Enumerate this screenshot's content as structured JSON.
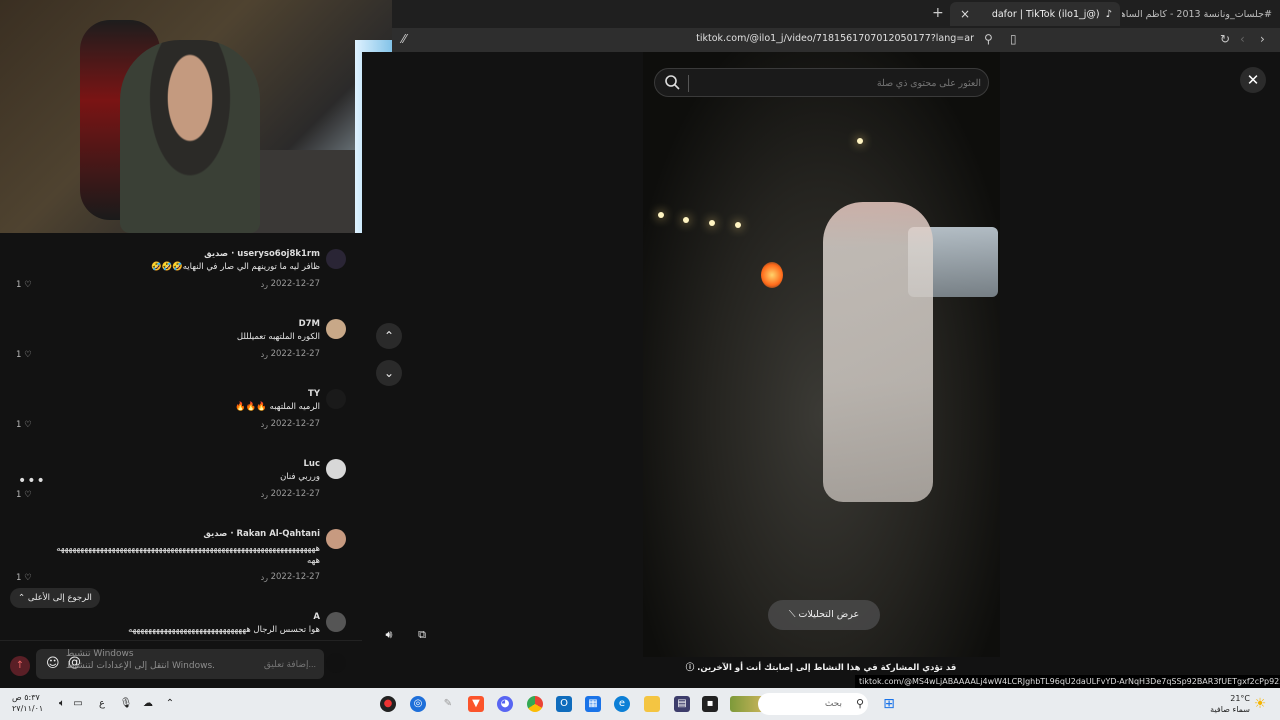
{
  "browser": {
    "active_tab_title": "(@ilo1_j) dafor | TikTok",
    "other_tab_title": "#جلسات_ونانسة 2013 - كاظم الساهر ...",
    "url": "tiktok.com/@ilo1_j/video/7181561707012050177?lang=ar"
  },
  "search": {
    "placeholder": "العثور على محتوى ذي صلة"
  },
  "comments": [
    {
      "user": "useryso6oj8k1rm · صديق",
      "text": "ظافر ليه ما تورينهم الي صار في النهايه🤣🤣🤣",
      "date": "2022-12-27",
      "reply": "رد",
      "likes": "1"
    },
    {
      "user": "D7M",
      "text": "الكوره الملتهبه تعميلللل",
      "date": "2022-12-27",
      "reply": "رد",
      "likes": "1"
    },
    {
      "user": "TY",
      "text": "الرميه الملتهبه 🔥🔥🔥",
      "date": "2022-12-27",
      "reply": "رد",
      "likes": "1"
    },
    {
      "user": "Luc",
      "text": "ورربي فنان",
      "date": "2022-12-27",
      "reply": "رد",
      "likes": "1"
    },
    {
      "user": "Rakan Al-Qahtani · صديق",
      "text": "ههههههههههههههههههههههههههههههههههههههههههههههههههههههههههههههههههه",
      "text2": "ههه",
      "date": "2022-12-27",
      "reply": "رد",
      "likes": "1"
    },
    {
      "user": "A",
      "text": "هوا تحسس الرجال ههههههههههههههههههههههههههههههه"
    }
  ],
  "back_to_top": "الرجوع إلى الأعلى ⌃",
  "comment_placeholder": "إضافة تعليق...",
  "activate_windows": [
    "تنشيط Windows",
    "انتقل إلى الإعدادات لتنشيط Windows."
  ],
  "video": {
    "analytics_label": "عرض التحليلات",
    "warning": "قد تؤدي المشاركة في هذا النشاط إلى إصابتك أنت أو الآخرين.",
    "status_url": "tiktok.com/@MS4wLjABAAAALj4wW4LCRJghbTL96qU2daULFvYD-ArNqH3De7qSSp92BAR3fUETgxf2cPp922vZ?lang=ar"
  },
  "taskbar": {
    "search_label": "بحث",
    "clock_time": "٥:٣٧ ص",
    "clock_date": "٢٧/١١/٠١",
    "weather_temp": "21°C",
    "weather_desc": "سماء صافية"
  },
  "colors": {
    "accent": "#fe2c55",
    "background": "#121212",
    "taskbar": "#e9ecef"
  }
}
